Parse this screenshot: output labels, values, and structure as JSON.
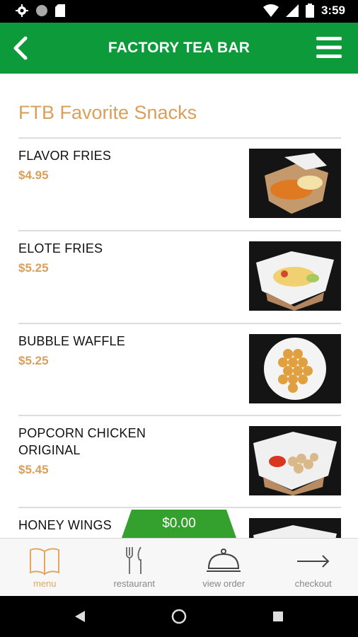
{
  "status_bar": {
    "time": "3:59"
  },
  "header": {
    "title": "FACTORY TEA BAR"
  },
  "section": {
    "title": "FTB Favorite Snacks"
  },
  "items": [
    {
      "name": "FLAVOR FRIES",
      "price": "$4.95"
    },
    {
      "name": "ELOTE FRIES",
      "price": "$5.25"
    },
    {
      "name": "BUBBLE WAFFLE",
      "price": "$5.25"
    },
    {
      "name": "POPCORN CHICKEN ORIGINAL",
      "price": "$5.45"
    },
    {
      "name": "HONEY WINGS"
    }
  ],
  "cart": {
    "total": "$0.00"
  },
  "nav": [
    {
      "label": "menu",
      "icon": "book-icon"
    },
    {
      "label": "restaurant",
      "icon": "fork-knife-icon"
    },
    {
      "label": "view order",
      "icon": "cloche-icon"
    },
    {
      "label": "checkout",
      "icon": "arrow-right-icon"
    }
  ],
  "colors": {
    "header_green": "#0d9a3a",
    "accent_gold": "#d9a05b",
    "cart_green": "#34a02e"
  }
}
